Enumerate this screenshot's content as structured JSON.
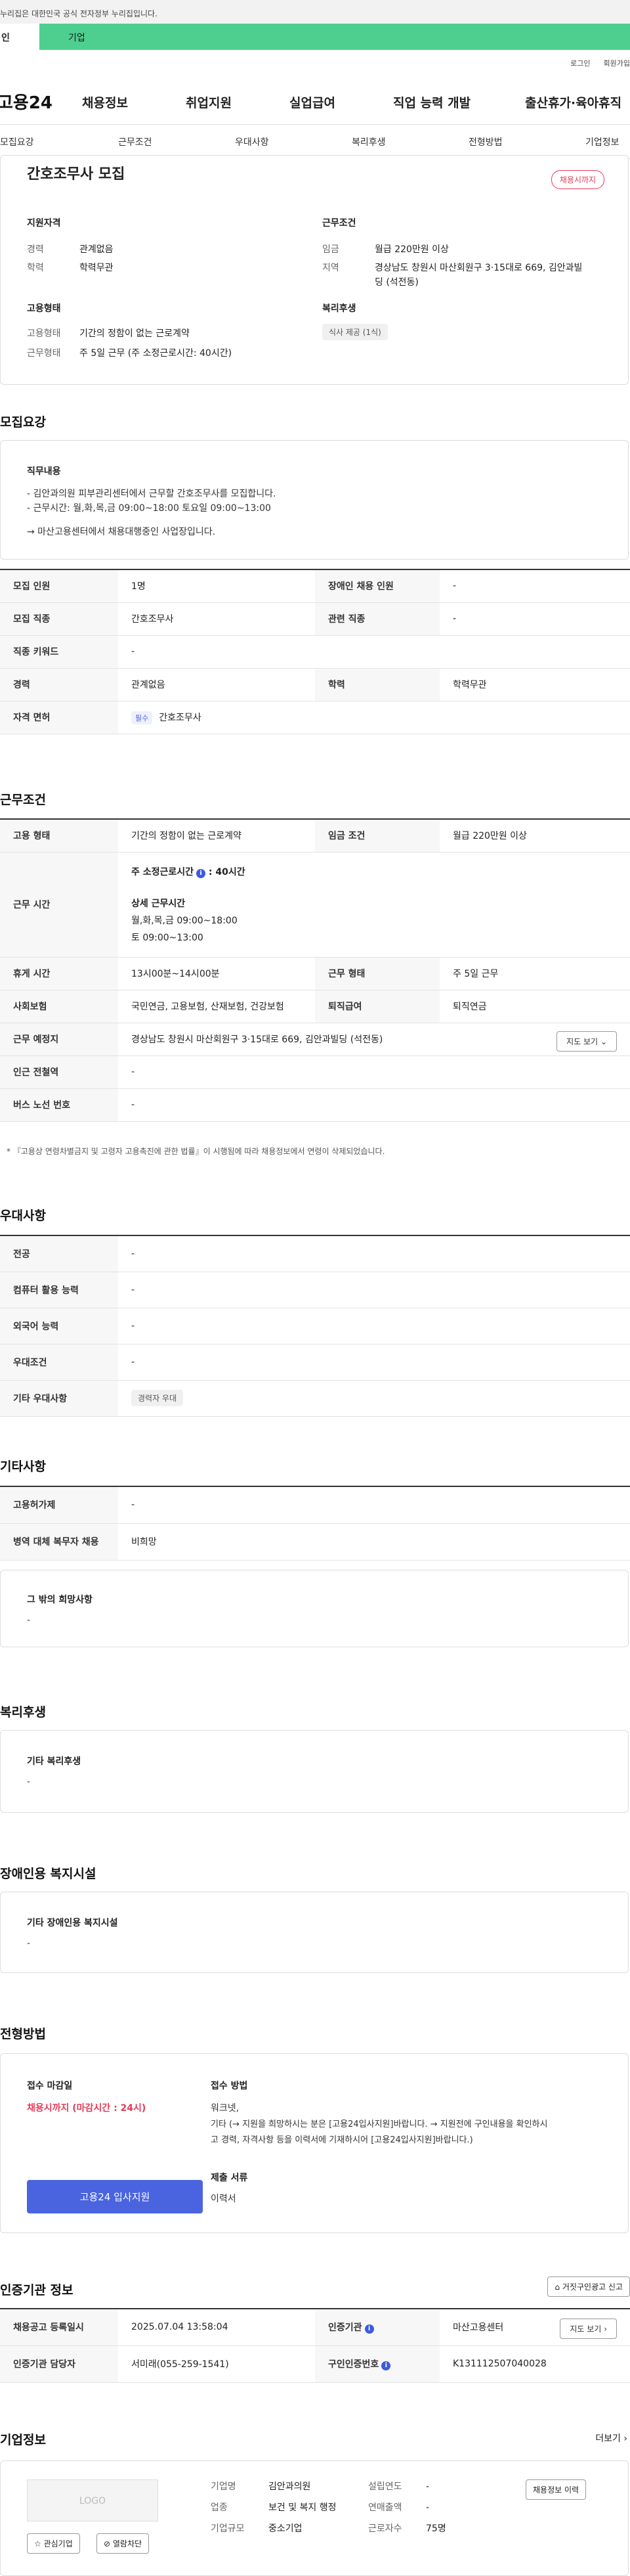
{
  "gov_bar": "누리집은 대한민국 공식 전자정부 누리집입니다.",
  "user_tabs": {
    "a": "인",
    "b": "기업"
  },
  "util": {
    "login": "로그인",
    "join": "회원가입"
  },
  "gnb": {
    "logo": "고용24",
    "items": [
      "채용정보",
      "취업지원",
      "실업급여",
      "직업 능력 개발",
      "출산휴가·육아휴직"
    ]
  },
  "subnav": [
    "모집요강",
    "근무조건",
    "우대사항",
    "복리후생",
    "전형방법",
    "기업정보"
  ],
  "summary": {
    "title": "간호조무사 모집",
    "badge": "채용시까지",
    "qual_title": "지원자격",
    "career_k": "경력",
    "career_v": "관계없음",
    "edu_k": "학력",
    "edu_v": "학력무관",
    "work_title": "근무조건",
    "wage_k": "임금",
    "wage_v": "월급 220만원 이상",
    "loc_k": "지역",
    "loc_v1": "경상남도 창원시 마산회원구 3·15대로 669, 김안과빌",
    "loc_v2": "딩 (석전동)",
    "emp_title": "고용형태",
    "emptype_k": "고용형태",
    "emptype_v": "기간의 정함이 없는 근로계약",
    "worktype_k": "근무형태",
    "worktype_v": "주 5일 근무 (주 소정근로시간: 40시간)",
    "welfare_title": "복리후생",
    "welfare_chip": "식사 제공 (1식)"
  },
  "recruit": {
    "section_title": "모집요강",
    "job_title": "직무내용",
    "job_line1": "- 김안과의원 피부관리센터에서 근무할 간호조무사를 모집합니다.",
    "job_line2": "- 근무시간: 월,화,목,금 09:00~18:00 토요일 09:00~13:00",
    "job_line3": "→ 마산고용센터에서 채용대행중인 사업장입니다.",
    "rows": [
      {
        "k1": "모집 인원",
        "v1": "1명",
        "k2": "장애인 채용 인원",
        "v2": "-"
      },
      {
        "k1": "모집 직종",
        "v1": "간호조무사",
        "k2": "관련 직종",
        "v2": "-"
      },
      {
        "k1": "직종 키워드",
        "v1": "-"
      },
      {
        "k1": "경력",
        "v1": "관계없음",
        "k2": "학력",
        "v2": "학력무관"
      },
      {
        "k1": "자격 면허",
        "chip": "필수",
        "v1": "간호조무사"
      }
    ]
  },
  "workcond": {
    "section_title": "근무조건",
    "emp_k": "고용 형태",
    "emp_v": "기간의 정함이 없는 근로계약",
    "wage_k": "임금 조건",
    "wage_v": "월급 220만원 이상",
    "hours_k": "근무 시간",
    "hours_weekly": "주 소정근로시간",
    "hours_weekly_v": "40시간",
    "hours_detail_title": "상세 근무시간",
    "hours_detail_1": "월,화,목,금 09:00~18:00",
    "hours_detail_2": "토 09:00~13:00",
    "rest_k": "휴게 시간",
    "rest_v": "13시00분~14시00분",
    "worktype_k": "근무 형태",
    "worktype_v": "주 5일 근무",
    "ins_k": "사회보험",
    "ins_v": "국민연금, 고용보험, 산재보험, 건강보험",
    "sev_k": "퇴직급여",
    "sev_v": "퇴직연금",
    "place_k": "근무 예정지",
    "place_v": "경상남도 창원시 마산회원구 3·15대로 669, 김안과빌딩 (석전동)",
    "map_btn": "지도 보기",
    "subway_k": "인근 전철역",
    "subway_v": "-",
    "bus_k": "버스 노선 번호",
    "bus_v": "-",
    "note": "* 『고용상 연령차별금지 및 고령자 고용촉진에 관한 법률』이 시행됨에 따라 채용정보에서 연령이 삭제되었습니다."
  },
  "pref": {
    "section_title": "우대사항",
    "rows": [
      {
        "k": "전공",
        "v": "-"
      },
      {
        "k": "컴퓨터 활용 능력",
        "v": "-"
      },
      {
        "k": "외국어 능력",
        "v": "-"
      },
      {
        "k": "우대조건",
        "v": "-"
      },
      {
        "k": "기타 우대사항",
        "chip": "경력자 우대"
      }
    ]
  },
  "etc": {
    "section_title": "기타사항",
    "rows": [
      {
        "k": "고용허가제",
        "v": "-"
      },
      {
        "k": "병역 대체 복무자 채용",
        "v": "비희망"
      }
    ],
    "other_title": "그 밖의 희망사항",
    "other_v": "-"
  },
  "welfare": {
    "section_title": "복리후생",
    "box_title": "기타 복리후생",
    "box_v": "-"
  },
  "disab": {
    "section_title": "장애인용 복지시설",
    "box_title": "기타 장애인용 복지시설",
    "box_v": "-"
  },
  "select": {
    "section_title": "전형방법",
    "deadline_title": "접수 마감일",
    "deadline_v": "채용시까지 (마감시간 : 24시)",
    "apply_btn": "고용24 입사지원",
    "method_title": "접수 방법",
    "method_1": "워크넷,",
    "method_2": "기타 (→ 지원을 희망하시는 분은 [고용24입사지원]바랍니다. → 지원전에 구인내용을 확인하시",
    "method_3": "고 경력, 자격사항 등을 이력서에 기재하시어 [고용24입사지원]바랍니다.)",
    "docs_title": "제출 서류",
    "docs_v": "이력서"
  },
  "cert": {
    "section_title": "인증기관 정보",
    "report_btn": "거짓구인광고 신고",
    "reg_k": "채용공고 등록일시",
    "reg_v": "2025.07.04 13:58:04",
    "org_k": "인증기관",
    "org_v": "마산고용센터",
    "map_btn": "지도 보기",
    "mgr_k": "인증기관 담당자",
    "mgr_v": "서미래(055-259-1541)",
    "num_k": "구인인증번호",
    "num_v": "K131112507040028"
  },
  "company": {
    "section_title": "기업정보",
    "more": "더보기",
    "logo": "LOGO",
    "fav_btn": "관심기업",
    "block_btn": "열람차단",
    "name_k": "기업명",
    "name_v": "김안과의원",
    "found_k": "설립연도",
    "found_v": "-",
    "ind_k": "업종",
    "ind_v": "보건 및 복지 행정",
    "sales_k": "연매출액",
    "sales_v": "-",
    "size_k": "기업규모",
    "size_v": "중소기업",
    "emp_k": "근로자수",
    "emp_v": "75명",
    "history_btn": "채용정보 이력"
  }
}
